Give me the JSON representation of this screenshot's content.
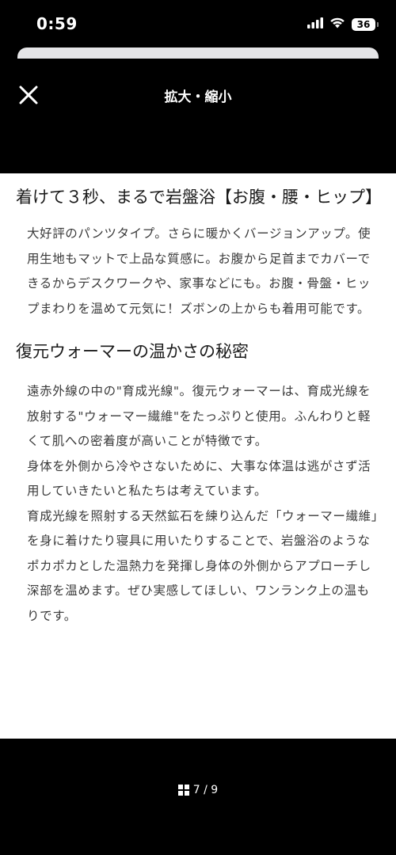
{
  "status_bar": {
    "time": "0:59",
    "battery": "36",
    "icons": [
      "signal-icon",
      "wifi-icon",
      "battery-icon"
    ]
  },
  "header": {
    "title": "拡大・縮小",
    "close_icon": "close-icon"
  },
  "content": {
    "heading1": "着けて３秒、まるで岩盤浴【お腹・腰・ヒップ】",
    "paragraph1": "大好評のパンツタイプ。さらに暖かくバージョンアップ。使用生地もマットで上品な質感に。お腹から足首までカバーできるからデスクワークや、家事などにも。お腹・骨盤・ヒップまわりを温めて元気に！ズボンの上からも着用可能です。",
    "heading2": "復元ウォーマーの温かさの秘密",
    "paragraph2": "遠赤外線の中の\"育成光線\"。復元ウォーマーは、育成光線を放射する\"ウォーマー繊維\"をたっぷりと使用。ふんわりと軽くて肌への密着度が高いことが特徴です。",
    "paragraph3": "身体を外側から冷やさないために、大事な体温は逃がさず活用していきたいと私たちは考えています。",
    "paragraph4": "育成光線を照射する天然鉱石を練り込んだ「ウォーマー繊維」を身に着けたり寝具に用いたりすることで、岩盤浴のようなポカポカとした温熱力を発揮し身体の外側からアプローチし深部を温めます。ぜひ実感してほしい、ワンランク上の温もりです。"
  },
  "pager": {
    "icon": "grid-icon",
    "label": "7 / 9"
  },
  "colors": {
    "background": "#000000",
    "content_bg": "#ffffff",
    "text": "#3a3a3a",
    "sheet_edge": "#e5e5e7"
  }
}
